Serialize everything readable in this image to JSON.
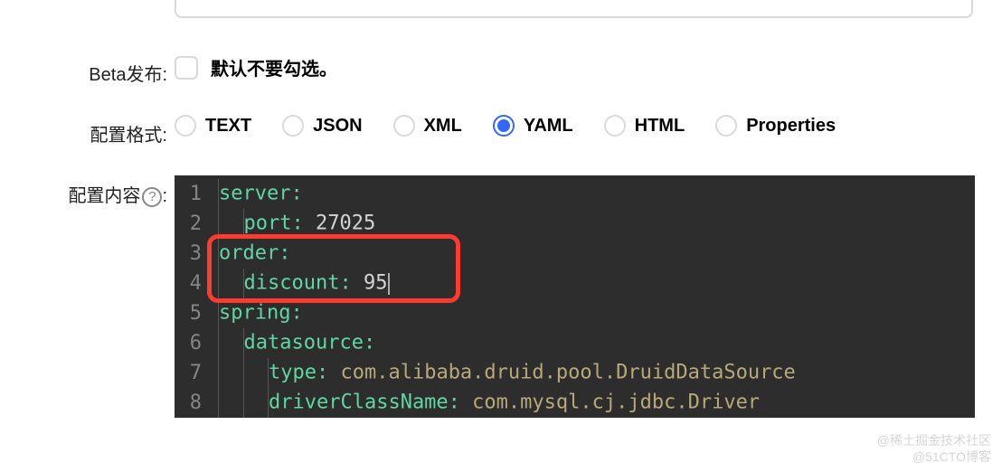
{
  "beta": {
    "label": "Beta发布:",
    "hint": "默认不要勾选。",
    "checked": false
  },
  "format": {
    "label": "配置格式:",
    "options": [
      "TEXT",
      "JSON",
      "XML",
      "YAML",
      "HTML",
      "Properties"
    ],
    "selected": "YAML"
  },
  "content": {
    "label_prefix": "配置内容",
    "label_suffix": ":",
    "help_icon": "?",
    "lines": [
      {
        "n": "1",
        "indent": 0,
        "key": "server",
        "val": ""
      },
      {
        "n": "2",
        "indent": 1,
        "key": "port",
        "val": "27025"
      },
      {
        "n": "3",
        "indent": 0,
        "key": "order",
        "val": ""
      },
      {
        "n": "4",
        "indent": 1,
        "key": "discount",
        "val": "95"
      },
      {
        "n": "5",
        "indent": 0,
        "key": "spring",
        "val": ""
      },
      {
        "n": "6",
        "indent": 1,
        "key": "datasource",
        "val": ""
      },
      {
        "n": "7",
        "indent": 2,
        "key": "type",
        "val": "com.alibaba.druid.pool.DruidDataSource",
        "string": true
      },
      {
        "n": "8",
        "indent": 2,
        "key": "driverClassName",
        "val": "com.mysql.cj.jdbc.Driver",
        "string": true
      }
    ],
    "highlight_start_line": 3,
    "highlight_end_line": 4
  },
  "watermark": {
    "line1": "@稀土掘金技术社区",
    "line2": "@51CTO博客"
  }
}
